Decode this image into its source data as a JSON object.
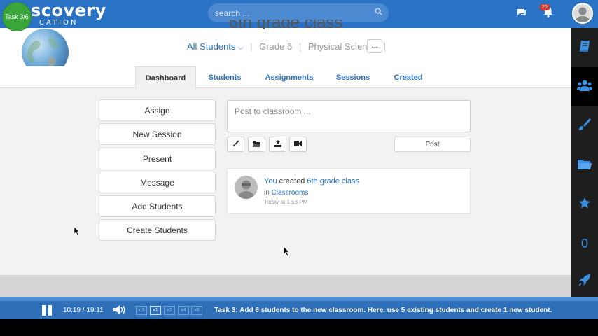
{
  "task_badge": "Task 3/6",
  "logo": {
    "line1": "scovery",
    "line2": "CATION"
  },
  "search": {
    "placeholder": "search ..."
  },
  "notifications": {
    "badge": "20"
  },
  "class": {
    "title": "6th grade class",
    "breadcrumb": [
      "All Students",
      "Grade 6",
      "Physical Science"
    ],
    "more_label": "..."
  },
  "tabs": [
    {
      "label": "Dashboard",
      "active": true
    },
    {
      "label": "Students"
    },
    {
      "label": "Assignments"
    },
    {
      "label": "Sessions"
    },
    {
      "label": "Created"
    }
  ],
  "actions": [
    "Assign",
    "New Session",
    "Present",
    "Message",
    "Add Students",
    "Create Students"
  ],
  "post": {
    "placeholder": "Post to classroom ...",
    "button": "Post"
  },
  "post_tools": [
    "brush-icon",
    "folder-icon",
    "upload-icon",
    "video-icon"
  ],
  "feed": {
    "actor": "You",
    "verb": " created ",
    "object": "6th grade class",
    "in_prefix": "in ",
    "location": "Classrooms",
    "time": "Today at 1:53 PM"
  },
  "sidebar_right": {
    "items": [
      "book-icon",
      "users-icon",
      "brush-icon",
      "folder-icon",
      "star-icon",
      "counter",
      "rocket-icon"
    ],
    "counter": "0"
  },
  "player": {
    "time": "10:19 / 19:11",
    "speeds": [
      "x.5",
      "x1",
      "x2",
      "x4",
      "x8"
    ],
    "active_speed": "x1",
    "task_text": "Task 3: Add 6 students to the new classroom. Here, use 5 existing students and create 1 new student."
  },
  "colors": {
    "brand_blue": "#2a72c4",
    "sidebar_dark": "#1e1e1e",
    "task_green": "#3aa53a"
  }
}
